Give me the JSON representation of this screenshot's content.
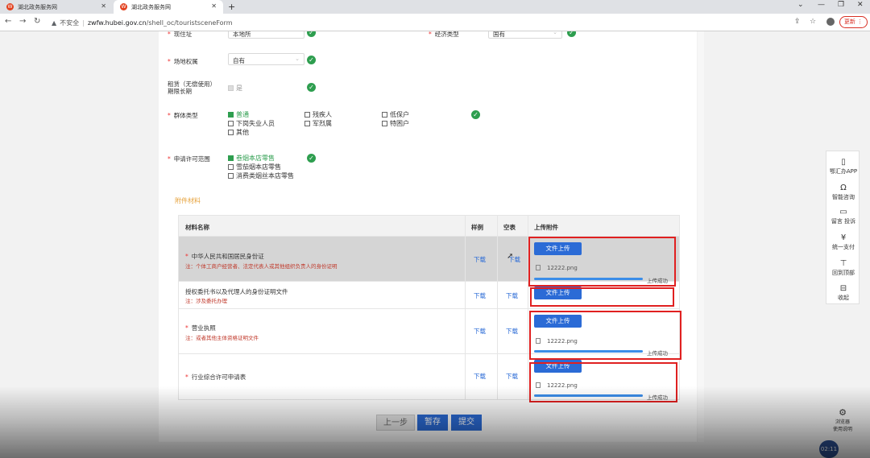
{
  "browser": {
    "tabs": [
      {
        "title": "湖北政务服务网",
        "active": false
      },
      {
        "title": "湖北政务服务网",
        "active": true
      }
    ],
    "new_tab": "+",
    "insecure_label": "不安全",
    "url_host": "zwfw.hubei.gov.cn",
    "url_path": "/shell_oc/touristsceneForm",
    "update_label": "更新",
    "favicon_text": "W"
  },
  "form": {
    "partial_row": {
      "label": "现住址",
      "value": "本地所",
      "right_label": "经济类型",
      "right_value": "国有"
    },
    "site_ownership": {
      "label": "场地权属",
      "value": "自有"
    },
    "lease": {
      "label_line1": "租赁（无偿使用）",
      "label_line2": "期限长期",
      "option": "是"
    },
    "group_type": {
      "label": "群体类型",
      "options": [
        {
          "text": "普通",
          "checked": true
        },
        {
          "text": "残疾人",
          "checked": false
        },
        {
          "text": "低保户",
          "checked": false
        },
        {
          "text": "下岗失业人员",
          "checked": false
        },
        {
          "text": "军烈属",
          "checked": false
        },
        {
          "text": "特困户",
          "checked": false
        },
        {
          "text": "其他",
          "checked": false
        }
      ]
    },
    "license_scope": {
      "label": "申请许可范围",
      "options": [
        {
          "text": "卷烟本店零售",
          "checked": true
        },
        {
          "text": "雪茄烟本店零售",
          "checked": false
        },
        {
          "text": "消费类烟丝本店零售",
          "checked": false
        }
      ]
    }
  },
  "attachments": {
    "section_title": "附件材料",
    "columns": [
      "材料名称",
      "样例",
      "空表",
      "上传附件"
    ],
    "upload_label": "文件上传",
    "download_label": "下载",
    "rows": [
      {
        "name": "中华人民共和国居民身份证",
        "required": true,
        "note": "注：个体工商户经营者、法定代表人或其他组织负责人的身份证明",
        "file": "12222.png",
        "status": "上传成功",
        "progress": 1.0
      },
      {
        "name": "授权委托书以及代理人的身份证明文件",
        "required": false,
        "note": "注：涉及委托办理",
        "file": "",
        "status": "",
        "progress": 0
      },
      {
        "name": "营业执照",
        "required": true,
        "note": "注：或者其他主体资格证明文件",
        "file": "12222.png",
        "status": "上传成功",
        "progress": 1.0
      },
      {
        "name": "行业综合许可申请表",
        "required": true,
        "note": "",
        "file": "12222.png",
        "status": "上传成功",
        "progress": 1.0
      }
    ]
  },
  "actions": {
    "prev": "上一步",
    "save": "暂存",
    "submit": "提交"
  },
  "float_toolbar": [
    {
      "icon": "phone-icon",
      "label": "鄂汇办APP"
    },
    {
      "icon": "headset-icon",
      "label": "智能咨询"
    },
    {
      "icon": "message-icon",
      "label": "留言 投诉"
    },
    {
      "icon": "yen-icon",
      "label": "统一支付"
    },
    {
      "icon": "top-icon",
      "label": "回到顶部"
    },
    {
      "icon": "collapse-icon",
      "label": "收起"
    }
  ],
  "helper": {
    "line1": "浏览器",
    "line2": "使用说明"
  },
  "time_badge": "02:11"
}
